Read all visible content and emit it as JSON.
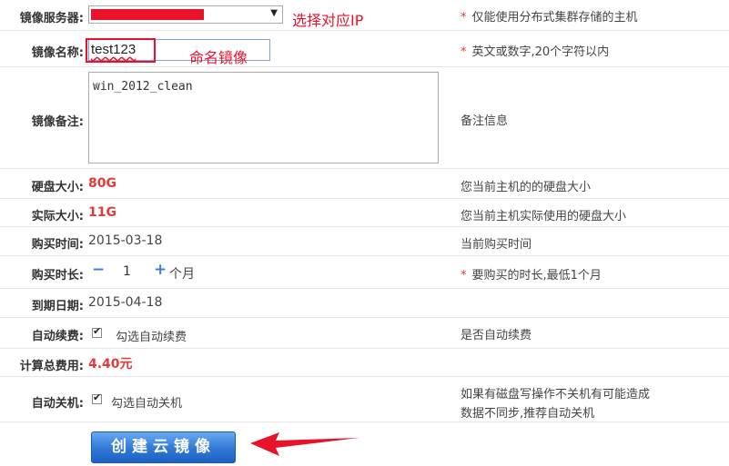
{
  "server": {
    "label": "镜像服务器:",
    "annotation": "选择对应IP",
    "hint": "仅能使用分布式集群存储的主机",
    "hint_star": "*"
  },
  "name": {
    "label": "镜像名称:",
    "value": "test123",
    "annotation": "命名镜像",
    "hint": "英文或数字,20个字符以内",
    "hint_star": "*"
  },
  "remark": {
    "label": "镜像备注:",
    "value": "win_2012_clean",
    "hint": "备注信息"
  },
  "disk_size": {
    "label": "硬盘大小:",
    "value": "80G",
    "hint": "您当前主机的的硬盘大小"
  },
  "actual_size": {
    "label": "实际大小:",
    "value": "11G",
    "hint": "您当前主机实际使用的硬盘大小"
  },
  "purchase_time": {
    "label": "购买时间:",
    "value": "2015-03-18",
    "hint": "当前购买时间"
  },
  "duration": {
    "label": "购买时长:",
    "minus": "−",
    "qty": "1",
    "plus": "+",
    "unit": "个月",
    "hint": "要购买的时长,最低1个月",
    "hint_star": "*"
  },
  "expiry": {
    "label": "到期日期:",
    "value": "2015-04-18"
  },
  "auto_renew": {
    "label": "自动续费:",
    "checkbox_label": "勾选自动续费",
    "checked": true,
    "hint": "是否自动续费"
  },
  "total": {
    "label": "计算总费用:",
    "value": "4.40元"
  },
  "auto_shutdown": {
    "label": "自动关机:",
    "checkbox_label": "勾选自动关机",
    "checked": true,
    "hint_line1": "如果有磁盘写操作不关机有可能造成",
    "hint_line2": "数据不同步,推荐自动关机"
  },
  "submit": {
    "label": "创建云镜像"
  },
  "colors": {
    "accent": "#2f78d6",
    "highlight": "#e4393c",
    "annotation": "#e8132b"
  }
}
